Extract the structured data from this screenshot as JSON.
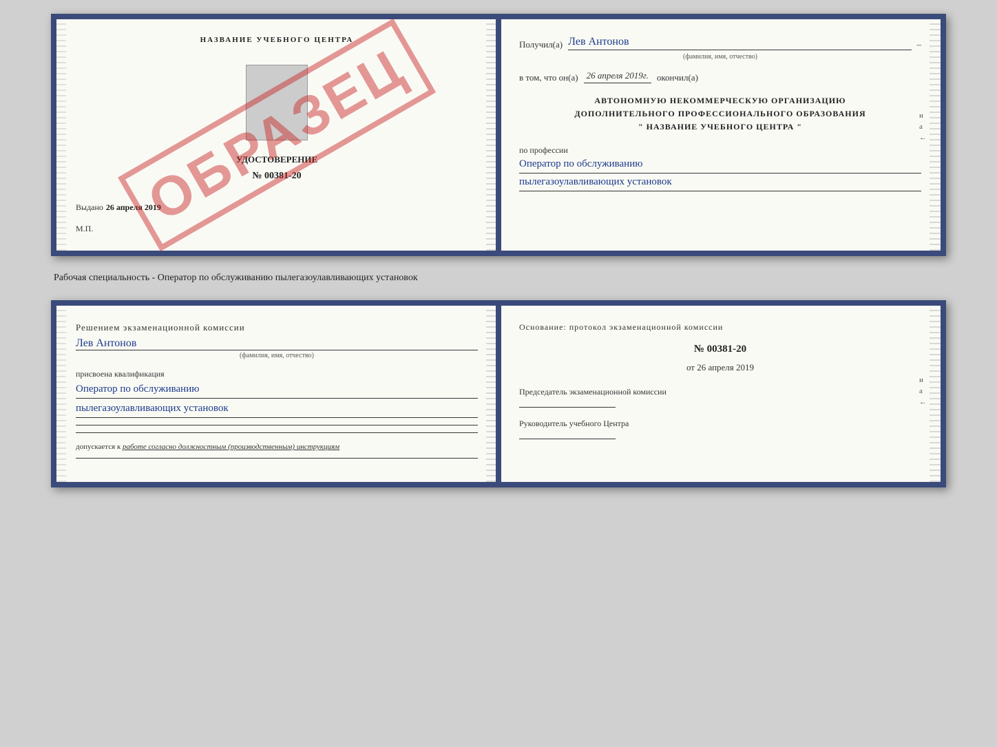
{
  "page": {
    "background": "#d0d0d0"
  },
  "topBook": {
    "left": {
      "section_title": "НАЗВАНИЕ УЧЕБНОГО ЦЕНТРА",
      "watermark": "ОБРАЗЕЦ",
      "cert_label": "УДОСТОВЕРЕНИЕ",
      "cert_number": "№ 00381-20",
      "photo_alt": "фото",
      "issued_prefix": "Выдано",
      "issued_date": "26 апреля 2019",
      "mp_label": "М.П."
    },
    "right": {
      "recipient_prefix": "Получил(а)",
      "recipient_name": "Лев Антонов",
      "recipient_fio_label": "(фамилия, имя, отчество)",
      "completed_prefix": "в том, что он(а)",
      "completed_date": "26 апреля 2019г.",
      "completed_suffix": "окончил(а)",
      "org_line1": "АВТОНОМНУЮ НЕКОММЕРЧЕСКУЮ ОРГАНИЗАЦИЮ",
      "org_line2": "ДОПОЛНИТЕЛЬНОГО ПРОФЕССИОНАЛЬНОГО ОБРАЗОВАНИЯ",
      "org_line3": "\" НАЗВАНИЕ УЧЕБНОГО ЦЕНТРА \"",
      "profession_label": "по профессии",
      "profession_line1": "Оператор по обслуживанию",
      "profession_line2": "пылегазоулавливающих установок"
    }
  },
  "middleText": "Рабочая специальность - Оператор по обслуживанию пылегазоулавливающих установок",
  "bottomBook": {
    "left": {
      "decision_text": "Решением экзаменационной комиссии",
      "person_name": "Лев Антонов",
      "fio_label": "(фамилия, имя, отчество)",
      "assigned_text": "присвоена квалификация",
      "qual_line1": "Оператор по обслуживанию",
      "qual_line2": "пылегазоулавливающих установок",
      "allowed_prefix": "допускается к",
      "allowed_text": "работе согласно должностным (производственным) инструкциям"
    },
    "right": {
      "basis_text": "Основание: протокол экзаменационной комиссии",
      "protocol_number": "№ 00381-20",
      "date_prefix": "от",
      "protocol_date": "26 апреля 2019",
      "chairman_label": "Председатель экзаменационной комиссии",
      "director_label": "Руководитель учебного Центра"
    }
  }
}
